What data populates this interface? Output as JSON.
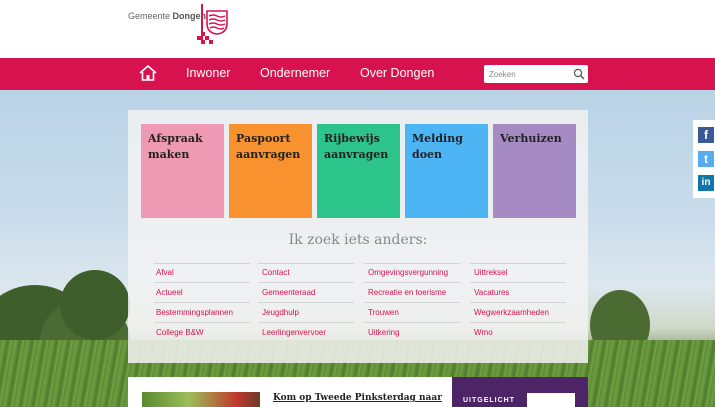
{
  "logo": {
    "prefix": "Gemeente ",
    "name": "Dongen",
    "icon": "dongen-coat-of-arms-icon"
  },
  "nav": {
    "home_icon": "home-icon",
    "items": [
      {
        "label": "Inwoner"
      },
      {
        "label": "Ondernemer"
      },
      {
        "label": "Over Dongen"
      }
    ]
  },
  "search": {
    "placeholder": "Zoeken",
    "icon": "search-icon"
  },
  "tiles": [
    {
      "label": "Afspraak maken",
      "color": "#ef9ab5"
    },
    {
      "label": "Paspoort aanvragen",
      "color": "#f7922e"
    },
    {
      "label": "Rijbewijs aanvragen",
      "color": "#2dc48c"
    },
    {
      "label": "Melding doen",
      "color": "#4eb5f5"
    },
    {
      "label": "Verhuizen",
      "color": "#a58ac4"
    }
  ],
  "zoek_heading": "Ik zoek iets anders:",
  "links": [
    [
      "Afval",
      "Actueel",
      "Bestemmingsplannen",
      "College B&W"
    ],
    [
      "Contact",
      "Gemeenteraad",
      "Jeugdhulp",
      "Leerlingenvervoer"
    ],
    [
      "Omgevingsvergunning",
      "Recreatie en toerisme",
      "Trouwen",
      "Uitkering"
    ],
    [
      "Uittreksel",
      "Vacatures",
      "Wegwerkzaamheden",
      "Wmo"
    ]
  ],
  "social": [
    {
      "icon": "facebook-icon",
      "glyph": "f",
      "color": "#3b5998"
    },
    {
      "icon": "twitter-icon",
      "glyph": "t",
      "color": "#55acee"
    },
    {
      "icon": "linkedin-icon",
      "glyph": "in",
      "color": "#0e76a8"
    }
  ],
  "news": {
    "title": "Kom op Tweede Pinksterdag naar"
  },
  "featured": {
    "label": "UITGELICHT"
  },
  "colors": {
    "brand": "#d8114f",
    "featured_bg": "#4d2466"
  }
}
